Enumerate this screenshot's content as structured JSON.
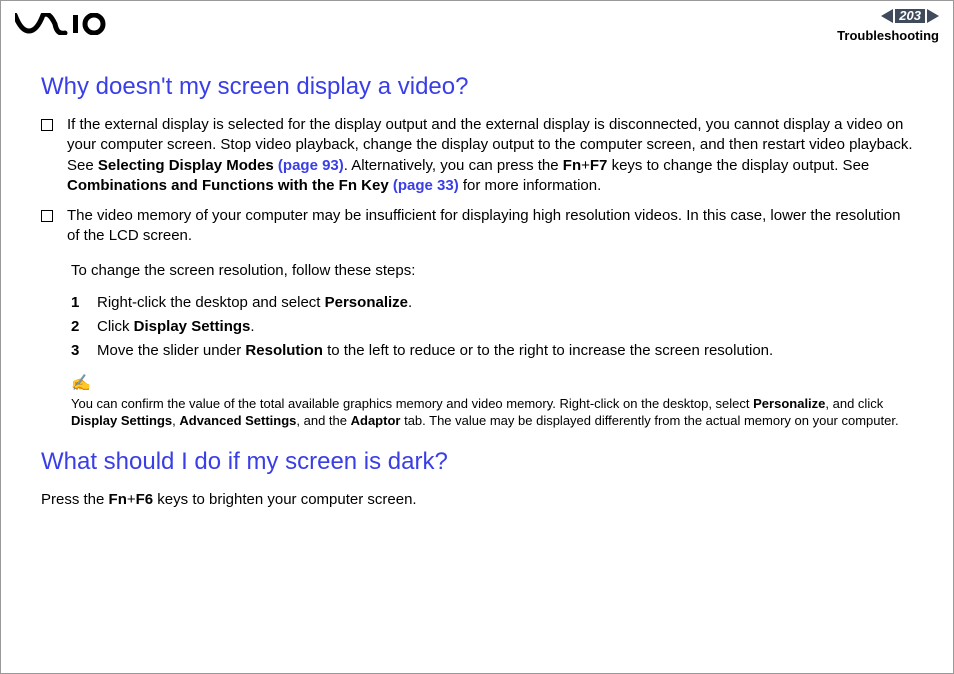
{
  "header": {
    "page_number": "203",
    "section": "Troubleshooting"
  },
  "heading1": "Why doesn't my screen display a video?",
  "bullet1": {
    "pre": "If the external display is selected for the display output and the external display is disconnected, you cannot display a video on your computer screen. Stop video playback, change the display output to the computer screen, and then restart video playback. See ",
    "b1": "Selecting Display Modes ",
    "l1": "(page 93)",
    "mid1": ". Alternatively, you can press the ",
    "b2": "Fn",
    "plus1": "+",
    "b3": "F7",
    "mid2": " keys to change the display output. See ",
    "b4": "Combinations and Functions with the Fn Key ",
    "l2": "(page 33)",
    "end": " for more information."
  },
  "bullet2": "The video memory of your computer may be insufficient for displaying high resolution videos. In this case, lower the resolution of the LCD screen.",
  "steps_intro": "To change the screen resolution, follow these steps:",
  "steps": {
    "s1": {
      "n": "1",
      "pre": "Right-click the desktop and select ",
      "b": "Personalize",
      "post": "."
    },
    "s2": {
      "n": "2",
      "pre": "Click ",
      "b": "Display Settings",
      "post": "."
    },
    "s3": {
      "n": "3",
      "pre": "Move the slider under ",
      "b": "Resolution",
      "post": " to the left to reduce or to the right to increase the screen resolution."
    }
  },
  "note_icon": "✍",
  "note": {
    "pre": "You can confirm the value of the total available graphics memory and video memory. Right-click on the desktop, select ",
    "b1": "Personalize",
    "m1": ", and click ",
    "b2": "Display Settings",
    "m2": ", ",
    "b3": "Advanced Settings",
    "m3": ", and the ",
    "b4": "Adaptor",
    "post": " tab. The value may be displayed differently from the actual memory on your computer."
  },
  "heading2": "What should I do if my screen is dark?",
  "final": {
    "pre": "Press the ",
    "b1": "Fn",
    "plus": "+",
    "b2": "F6",
    "post": " keys to brighten your computer screen."
  }
}
